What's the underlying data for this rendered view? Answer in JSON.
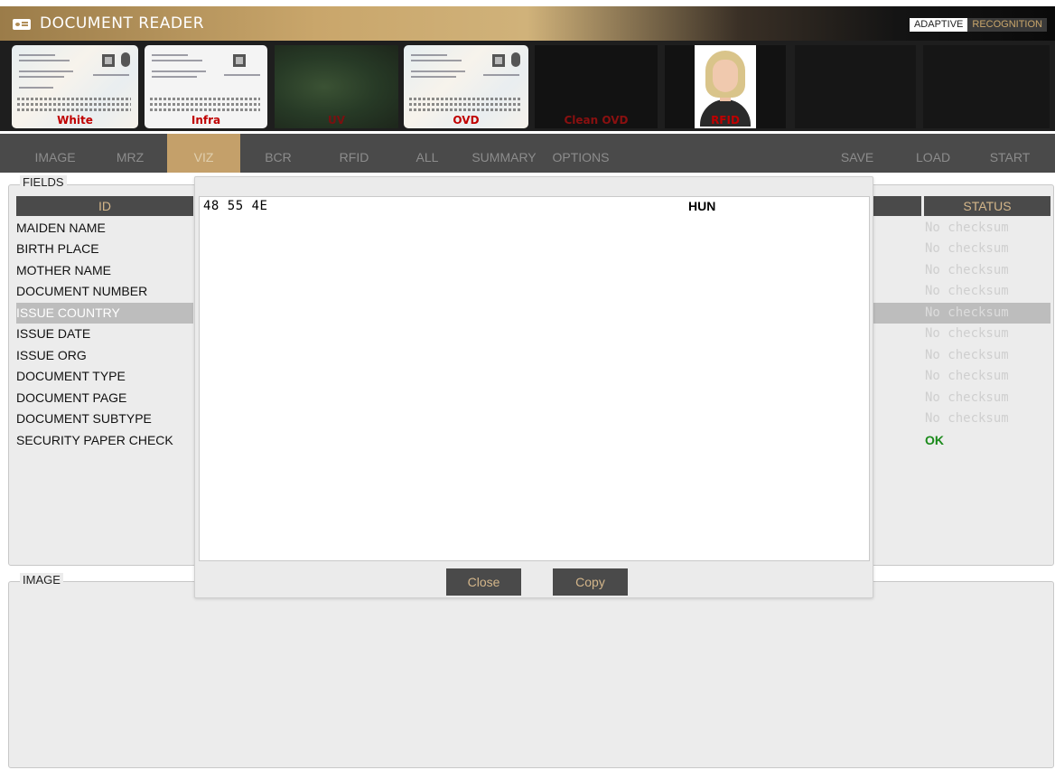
{
  "app": {
    "title": "DOCUMENT READER",
    "brand": {
      "part1": "ADAPTIVE",
      "part2": "RECOGNITION"
    }
  },
  "thumbnails": [
    {
      "label": "White"
    },
    {
      "label": "Infra"
    },
    {
      "label": "UV"
    },
    {
      "label": "OVD"
    },
    {
      "label": "Clean OVD"
    },
    {
      "label": "RFID"
    }
  ],
  "menu": {
    "left": [
      "IMAGE",
      "MRZ",
      "VIZ",
      "BCR",
      "RFID",
      "ALL",
      "SUMMARY",
      "OPTIONS"
    ],
    "right": [
      "SAVE",
      "LOAD",
      "START"
    ],
    "active": "VIZ"
  },
  "fields_panel": {
    "legend": "FIELDS",
    "columns": {
      "id": "ID",
      "status": "STATUS"
    },
    "rows": [
      {
        "id": "MAIDEN NAME",
        "status": "No checksum"
      },
      {
        "id": "BIRTH PLACE",
        "status": "No checksum"
      },
      {
        "id": "MOTHER NAME",
        "status": "No checksum"
      },
      {
        "id": "DOCUMENT NUMBER",
        "status": "No checksum"
      },
      {
        "id": "ISSUE COUNTRY",
        "status": "No checksum",
        "selected": true
      },
      {
        "id": "ISSUE DATE",
        "status": "No checksum"
      },
      {
        "id": "ISSUE ORG",
        "status": "No checksum"
      },
      {
        "id": "DOCUMENT TYPE",
        "status": "No checksum"
      },
      {
        "id": "DOCUMENT PAGE",
        "status": "No checksum"
      },
      {
        "id": "DOCUMENT SUBTYPE",
        "status": "No checksum"
      },
      {
        "id": "SECURITY PAPER CHECK",
        "status": "OK"
      }
    ]
  },
  "image_panel": {
    "legend": "IMAGE"
  },
  "dialog": {
    "hex": "48 55 4E",
    "decoded": "HUN",
    "close_label": "Close",
    "copy_label": "Copy"
  },
  "colors": {
    "accent": "#c4a06a",
    "header_bg": "#4a4a4a",
    "header_text": "#d4b68a",
    "ok": "#1a8a1a",
    "thumb_label": "#c00000"
  }
}
